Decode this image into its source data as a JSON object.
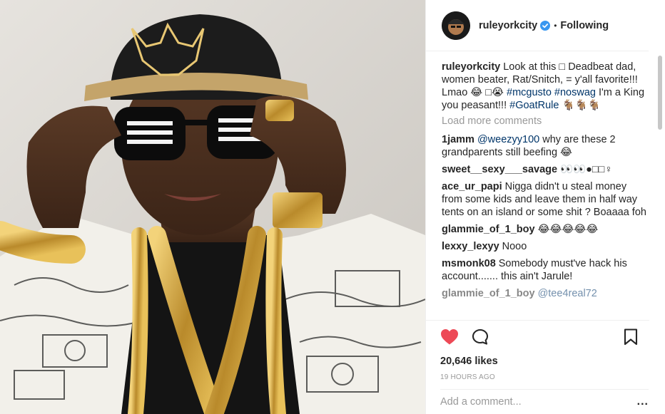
{
  "header": {
    "username": "ruleyorkcity",
    "verified_icon": "verified-badge-icon",
    "separator": "•",
    "follow_state": "Following"
  },
  "caption": {
    "username": "ruleyorkcity",
    "text_1": "Look at this □ Deadbeat dad, women beater, Rat/Snitch, = y'all favorite!!! Lmao 😂 □😭",
    "hashtag_1": "#mcgusto",
    "hashtag_2": "#noswag",
    "text_2": "I'm a King you peasant!!!",
    "hashtag_3": "#GoatRule",
    "text_3": "🐐🐐🐐"
  },
  "load_more": "Load more comments",
  "comments": [
    {
      "username": "1jamm",
      "mention": "@weezyy100",
      "text": "why are these 2 grandparents still beefing 😂"
    },
    {
      "username": "sweet__sexy___savage",
      "mention": "",
      "text": "👀👀●□□♀"
    },
    {
      "username": "ace_ur_papi",
      "mention": "",
      "text": "Nigga didn't u steal money from some kids and leave them in half way tents on an island or some shit ? Boaaaa foh"
    },
    {
      "username": "glammie_of_1_boy",
      "mention": "",
      "text": "😂😂😂😂😂"
    },
    {
      "username": "lexxy_lexyy",
      "mention": "",
      "text": "Nooo"
    },
    {
      "username": "msmonk08",
      "mention": "",
      "text": "Somebody must've hack his account....... this ain't Jarule!"
    },
    {
      "username": "glammie_of_1_boy",
      "mention": "@tee4real72",
      "text": ""
    }
  ],
  "actions": {
    "like_icon": "heart-icon",
    "comment_icon": "comment-icon",
    "save_icon": "bookmark-icon",
    "likes": "20,646 likes",
    "time_ago": "19 HOURS AGO"
  },
  "add_comment": {
    "placeholder": "Add a comment...",
    "more": "..."
  },
  "colors": {
    "like_red": "#ed4956",
    "verified_blue": "#3897f0",
    "link": "#003569",
    "muted": "#999999"
  }
}
